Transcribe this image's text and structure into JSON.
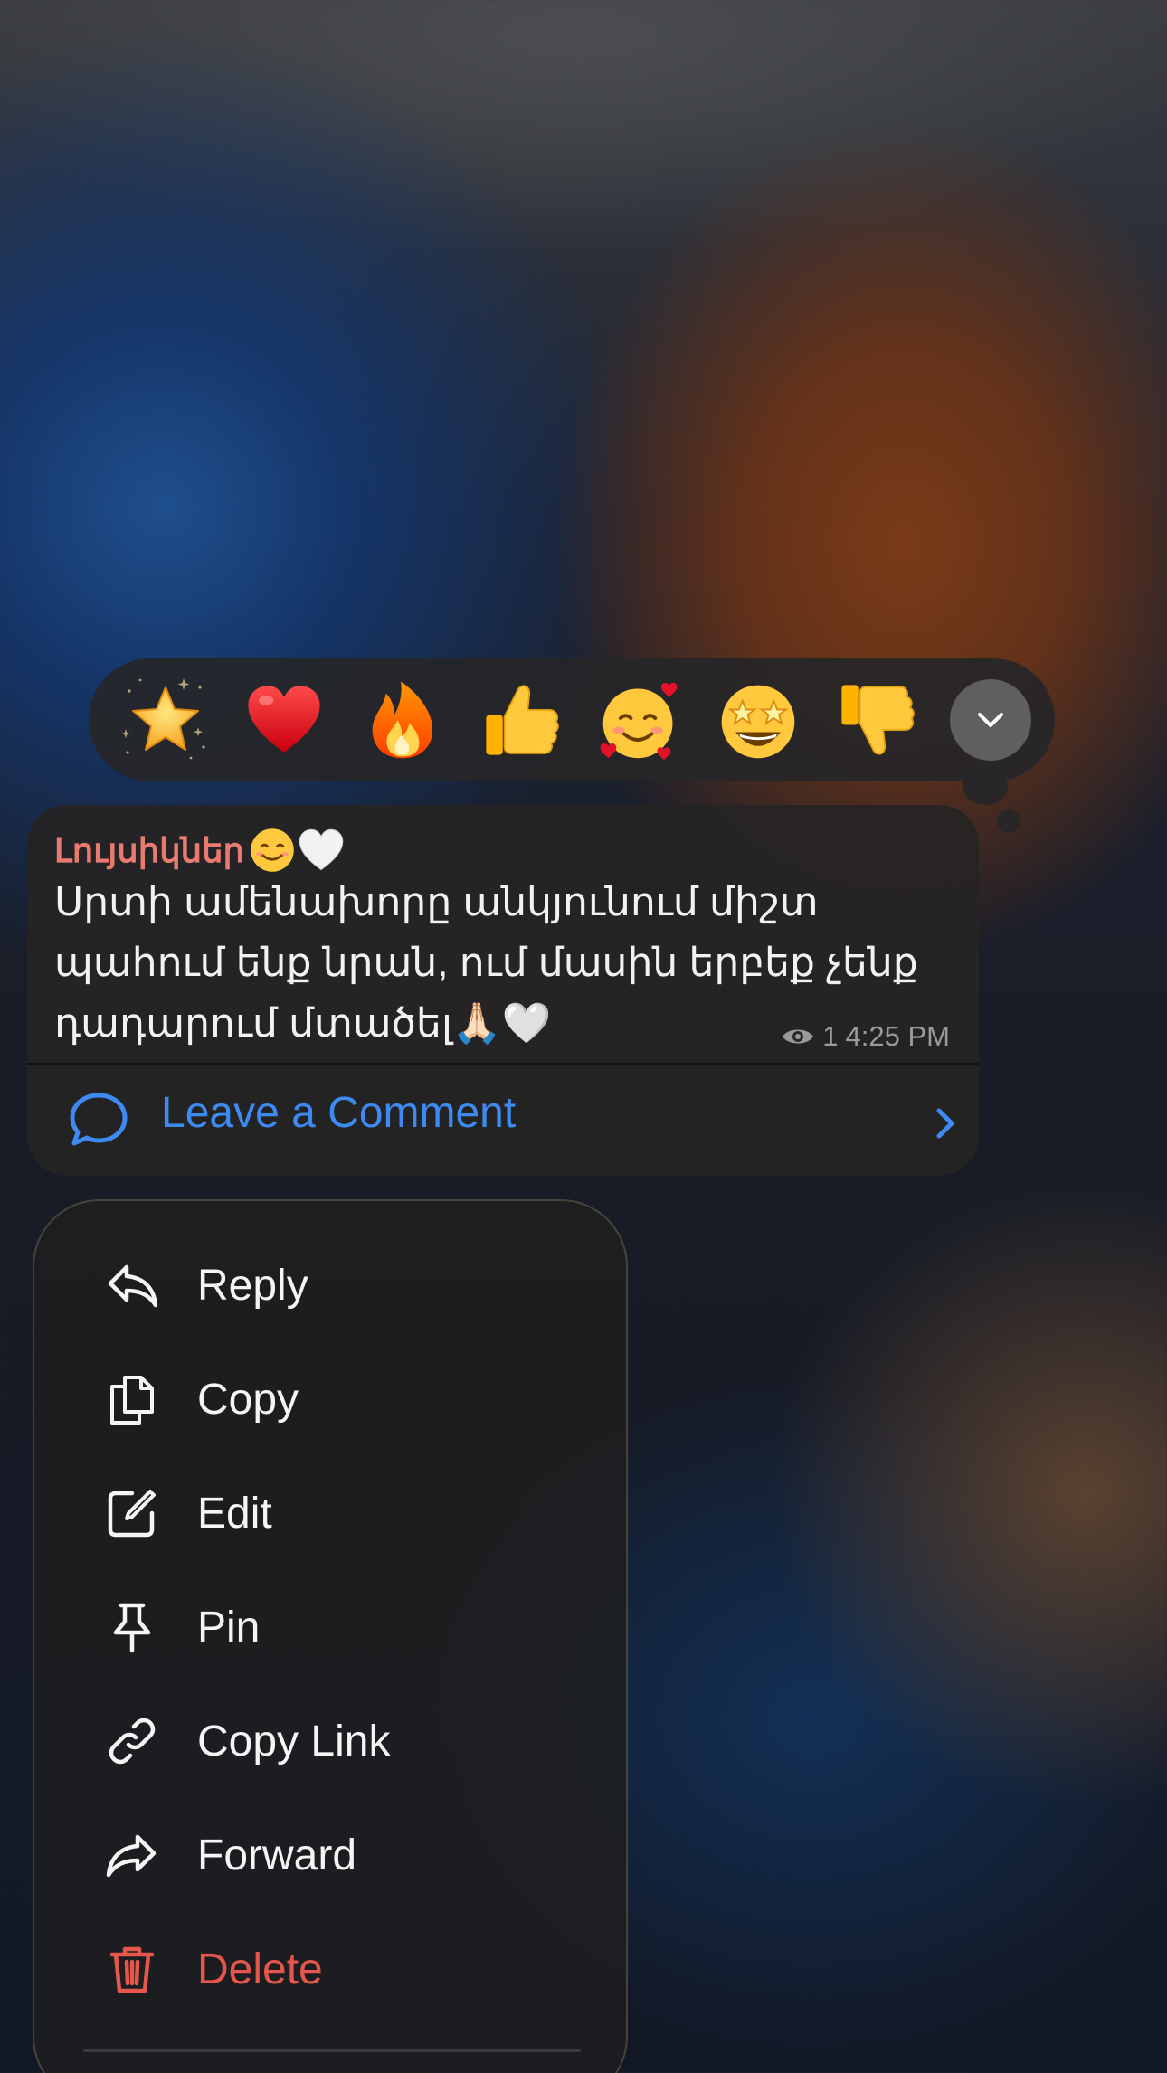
{
  "reactions": [
    {
      "name": "star",
      "emoji": "⭐"
    },
    {
      "name": "red-heart",
      "emoji": "❤️"
    },
    {
      "name": "fire",
      "emoji": "🔥"
    },
    {
      "name": "thumbs-up",
      "emoji": "👍"
    },
    {
      "name": "smiling-face-with-hearts",
      "emoji": "🥰"
    },
    {
      "name": "star-struck",
      "emoji": "🤩"
    },
    {
      "name": "thumbs-down",
      "emoji": "👎"
    }
  ],
  "message": {
    "sender": "Լույսիկներ",
    "sender_emojis": "😊🤍",
    "text": "Սրտի ամենախորը անկյունում միշտ պահում ենք նրան, ում մասին երբեք չենք դադարում մտածել🙏🏻🤍",
    "views": "1",
    "time": "4:25 PM",
    "comment_label": "Leave a Comment"
  },
  "menu": {
    "items": [
      {
        "label": "Reply",
        "icon": "reply-icon"
      },
      {
        "label": "Copy",
        "icon": "copy-icon"
      },
      {
        "label": "Edit",
        "icon": "edit-icon"
      },
      {
        "label": "Pin",
        "icon": "pin-icon"
      },
      {
        "label": "Copy Link",
        "icon": "link-icon"
      },
      {
        "label": "Forward",
        "icon": "forward-icon"
      },
      {
        "label": "Delete",
        "icon": "trash-icon"
      }
    ]
  },
  "colors": {
    "accent": "#3d8bf2",
    "sender": "#e87a6f",
    "danger": "#e5574a"
  }
}
